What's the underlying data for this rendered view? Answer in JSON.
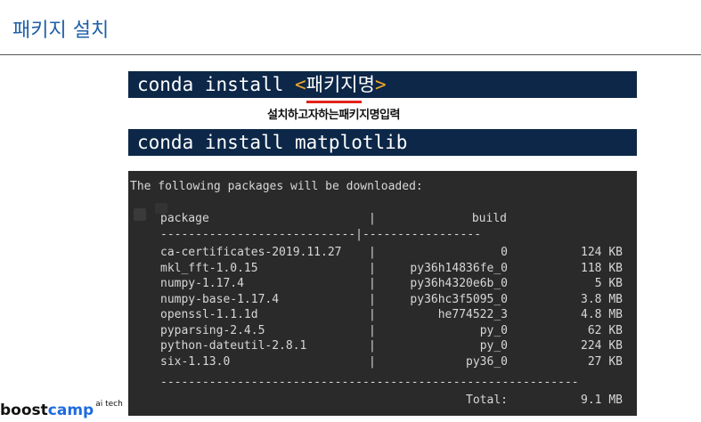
{
  "slide": {
    "title": "패키지 설치"
  },
  "command1": {
    "prefix": "conda install ",
    "lt": "<",
    "placeholder": "패키지명",
    "gt": ">"
  },
  "hint": "설치하고자하는패키지명입력",
  "command2": {
    "text": "conda install matplotlib"
  },
  "terminal": {
    "intro": "The following packages will be downloaded:",
    "headers": {
      "package": "package",
      "build": "build"
    },
    "header_sep": "|",
    "dash_line": "----------------------------|-----------------",
    "rows": [
      {
        "package": "ca-certificates-2019.11.27",
        "build": "0",
        "size": "124 KB"
      },
      {
        "package": "mkl_fft-1.0.15",
        "build": "py36h14836fe_0",
        "size": "118 KB"
      },
      {
        "package": "numpy-1.17.4",
        "build": "py36h4320e6b_0",
        "size": "5 KB"
      },
      {
        "package": "numpy-base-1.17.4",
        "build": "py36hc3f5095_0",
        "size": "3.8 MB"
      },
      {
        "package": "openssl-1.1.1d",
        "build": "he774522_3",
        "size": "4.8 MB"
      },
      {
        "package": "pyparsing-2.4.5",
        "build": "py_0",
        "size": "62 KB"
      },
      {
        "package": "python-dateutil-2.8.1",
        "build": "py_0",
        "size": "224 KB"
      },
      {
        "package": "six-1.13.0",
        "build": "py36_0",
        "size": "27 KB"
      }
    ],
    "footer_dashes": "------------------------------------------------------------",
    "total_label": "Total:",
    "total_value": "9.1 MB"
  },
  "logo": {
    "boost": "boost",
    "camp": "camp",
    "sup": "ai tech"
  }
}
